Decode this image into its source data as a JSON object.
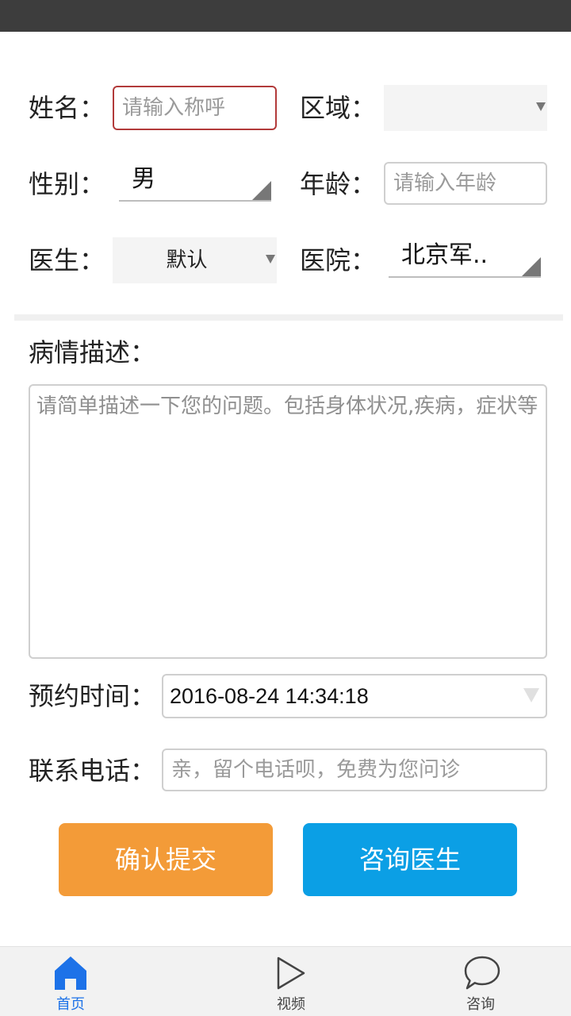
{
  "form": {
    "name_label": "姓名：",
    "name_placeholder": "请输入称呼",
    "region_label": "区域：",
    "region_value": "",
    "gender_label": "性别：",
    "gender_value": "男",
    "age_label": "年龄：",
    "age_placeholder": "请输入年龄",
    "doctor_label": "医生：",
    "doctor_value": "默认",
    "hospital_label": "医院：",
    "hospital_value": "北京军..",
    "description_label": "病情描述：",
    "description_placeholder": "请简单描述一下您的问题。包括身体状况,疾病，症状等",
    "appointment_label": "预约时间：",
    "appointment_value": "2016-08-24 14:34:18",
    "phone_label": "联系电话：",
    "phone_placeholder": "亲，留个电话呗，免费为您问诊"
  },
  "actions": {
    "submit_label": "确认提交",
    "consult_label": "咨询医生"
  },
  "tabbar": {
    "items": [
      {
        "label": "首页",
        "icon": "home-icon",
        "active": true
      },
      {
        "label": "视频",
        "icon": "play-icon",
        "active": false
      },
      {
        "label": "咨询",
        "icon": "chat-bubble-icon",
        "active": false
      }
    ]
  },
  "colors": {
    "accent_blue": "#1d72e8",
    "submit_orange": "#f39b38",
    "consult_blue": "#0b9fe5",
    "status_bar": "#3d3d3d",
    "focus_border": "#b23a3a"
  }
}
